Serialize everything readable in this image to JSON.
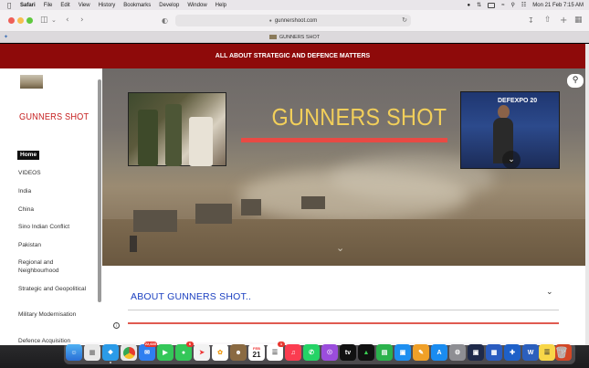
{
  "menubar": {
    "app": "Safari",
    "items": [
      "File",
      "Edit",
      "View",
      "History",
      "Bookmarks",
      "Develop",
      "Window",
      "Help"
    ],
    "datetime": "Mon 21 Feb  7:15 AM"
  },
  "browser": {
    "url": "gunnershoot.com",
    "tab_title": "GUNNERS SHOT"
  },
  "site": {
    "banner": "ALL ABOUT STRATEGIC AND DEFENCE MATTERS",
    "sidebar_title": "GUNNERS SHOT",
    "nav": [
      "Home",
      "VIDEOS",
      "India",
      "China",
      "Sino Indian Conflict",
      "Pakistan",
      "Regional and Neighbourhood",
      "Strategic and Geopolitical",
      "Military Modernisation",
      "Defence Acquisition"
    ],
    "hero_title": "GUNNERS SHOT",
    "defexpo_text": "DEFEXPO 20",
    "about_heading": "ABOUT GUNNERS SHOT.."
  },
  "dock": {
    "mail_badge": "22,630",
    "messages_badge": "6",
    "calendar_month": "FEB",
    "calendar_day": "21",
    "reminders_badge": "1"
  },
  "colors": {
    "banner": "#8e0a0a",
    "sidebar_title": "#c62020",
    "hero_title": "#f2cf5a",
    "accent_line": "#e84a44",
    "about_link": "#1a3fc0"
  }
}
